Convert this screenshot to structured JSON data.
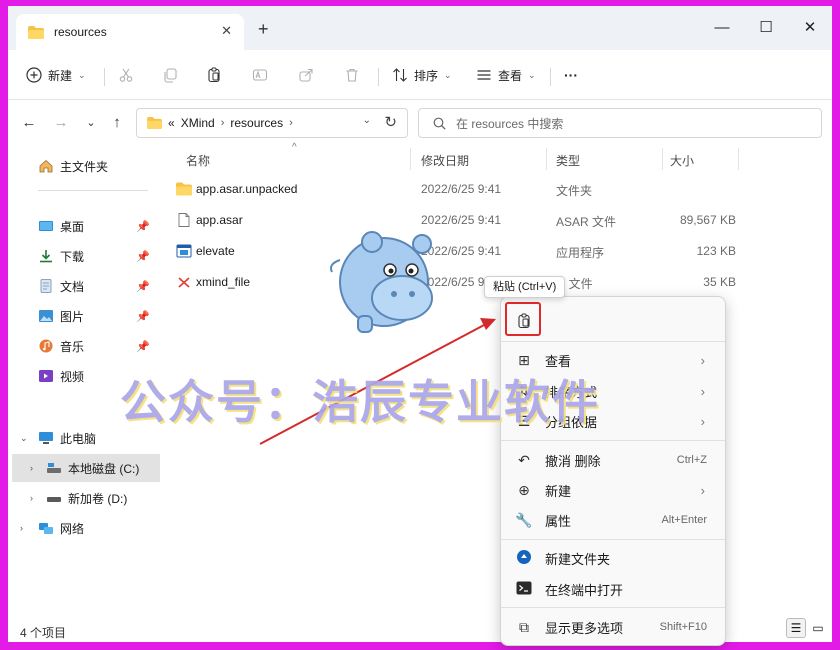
{
  "window": {
    "tab_title": "resources",
    "new_tab": "+",
    "controls": {
      "minimize": "—",
      "maximize": "☐",
      "close": "✕"
    }
  },
  "toolbar": {
    "new_label": "新建",
    "sort_label": "排序",
    "view_label": "查看",
    "more_label": "···"
  },
  "address": {
    "overflow": "«",
    "segments": [
      "XMind",
      "resources"
    ],
    "search_placeholder": "在 resources 中搜索"
  },
  "sidebar": {
    "home": "主文件夹",
    "quick": [
      {
        "label": "桌面",
        "icon": "desktop-icon"
      },
      {
        "label": "下载",
        "icon": "download-icon"
      },
      {
        "label": "文档",
        "icon": "document-icon"
      },
      {
        "label": "图片",
        "icon": "pictures-icon"
      },
      {
        "label": "音乐",
        "icon": "music-icon"
      },
      {
        "label": "视频",
        "icon": "video-icon"
      }
    ],
    "this_pc": "此电脑",
    "drive_c": "本地磁盘 (C:)",
    "drive_d": "新加卷 (D:)",
    "network": "网络"
  },
  "columns": {
    "name": "名称",
    "date": "修改日期",
    "type": "类型",
    "size": "大小"
  },
  "files": [
    {
      "name": "app.asar.unpacked",
      "date": "2022/6/25 9:41",
      "type": "文件夹",
      "size": ""
    },
    {
      "name": "app.asar",
      "date": "2022/6/25 9:41",
      "type": "ASAR 文件",
      "size": "89,567 KB"
    },
    {
      "name": "elevate",
      "date": "2022/6/25 9:41",
      "type": "应用程序",
      "size": "123 KB"
    },
    {
      "name": "xmind_file",
      "date": "2022/6/25 9",
      "type": "O 文件",
      "size": "35 KB"
    }
  ],
  "status": {
    "count": "4 个项目"
  },
  "context_menu": {
    "tooltip": "粘贴 (Ctrl+V)",
    "view": "查看",
    "sort": "排序方式",
    "group": "分组依据",
    "undo": "撤消 删除",
    "undo_shortcut": "Ctrl+Z",
    "new": "新建",
    "properties": "属性",
    "properties_shortcut": "Alt+Enter",
    "new_folder": "新建文件夹",
    "open_terminal": "在终端中打开",
    "more_options": "显示更多选项",
    "more_shortcut": "Shift+F10"
  },
  "watermark": "公众号：浩辰专业软件",
  "colors": {
    "border": "#e21be6",
    "accent": "#0067c0",
    "highlight": "#e02a2a"
  }
}
